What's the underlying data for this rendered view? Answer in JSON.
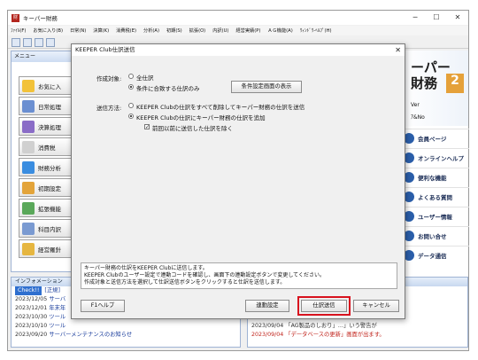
{
  "app": {
    "title": "キーパー財務",
    "icon_label": "財",
    "controls": {
      "minimize": "─",
      "maximize": "☐",
      "close": "✕"
    }
  },
  "menubar": [
    "ﾌｧｲﾙ(F)",
    "お気に入り(B)",
    "日常(N)",
    "決算(K)",
    "消費税(E)",
    "分析(A)",
    "初期(S)",
    "拡張(O)",
    "内訳(U)",
    "経営実績(P)",
    "ＡＧ機能(A)",
    "ｳｨﾝﾄﾞｳ-ﾍﾙﾌﾟ(H)"
  ],
  "menu_panel": {
    "header": "メニュー",
    "items": [
      "お気に入",
      "日常処理",
      "決算処理",
      "消費税",
      "財務分析",
      "初期設定",
      "拡張機能",
      "科目内訳",
      "経営羅針"
    ]
  },
  "brand": {
    "name1": "ーパー",
    "name2": "財務",
    "accent": "2",
    "version": "Ver",
    "number": "ｱ&No",
    "links": [
      "会員ページ",
      "オンラインヘルプ",
      "便利な機能",
      "よくある質問",
      "ユーザー情報",
      "お問い合せ",
      "データ通信"
    ]
  },
  "info_panel": {
    "header": "インフォメーション",
    "badge": "Check!!",
    "badge_text": "[正規]",
    "rows": [
      {
        "date": "2023/12/05",
        "text": "サーバ"
      },
      {
        "date": "2023/12/01",
        "text": "年末年"
      },
      {
        "date": "2023/10/30",
        "text": "ツール"
      },
      {
        "date": "2023/10/10",
        "text": "ツール"
      },
      {
        "date": "2023/09/20",
        "text": "サーバーメンテナンスのお知らせ"
      }
    ]
  },
  "news_panel": {
    "rows": [
      {
        "text": "",
        "red": false
      },
      {
        "text": "答方法は？",
        "red": false
      },
      {
        "text": "",
        "red": false
      },
      {
        "text": "",
        "red": false
      },
      {
        "text": "2023/09/04 「AG製品のしおり」…」いう警告が",
        "red": false
      },
      {
        "text": "2023/09/04 「データベースの更新」画面が出ます。",
        "red": true
      }
    ]
  },
  "dialog": {
    "title": "KEEPER Club仕訳送信",
    "close": "✕",
    "target_label": "作成対象:",
    "target_all": "全仕訳",
    "target_cond": "条件に合致する仕訳のみ",
    "cond_button": "条件設定画面の表示",
    "method_label": "送信方法:",
    "method_delete": "KEEPER Clubの仕訳をすべて削除してキーパー財務の仕訳を送信",
    "method_add": "KEEPER Clubの仕訳にキーパー財務の仕訳を追加",
    "exclude_prev": "前回以前に送信した仕訳を除く",
    "check_mark": "✓",
    "message": [
      "キーパー財務の仕訳をKEEPER Clubに送信します。",
      "KEEPER Clubのユーザー設定で連動コードを確認し、画面下の連動設定ボタンで変更してください。",
      "作成対象と送信方法を選択して仕訳送信ボタンをクリックすると仕訳を送信します。"
    ],
    "f1_help": "F1ヘルプ",
    "link_settings": "連動設定",
    "send": "仕訳送信",
    "cancel": "キャンセル"
  }
}
